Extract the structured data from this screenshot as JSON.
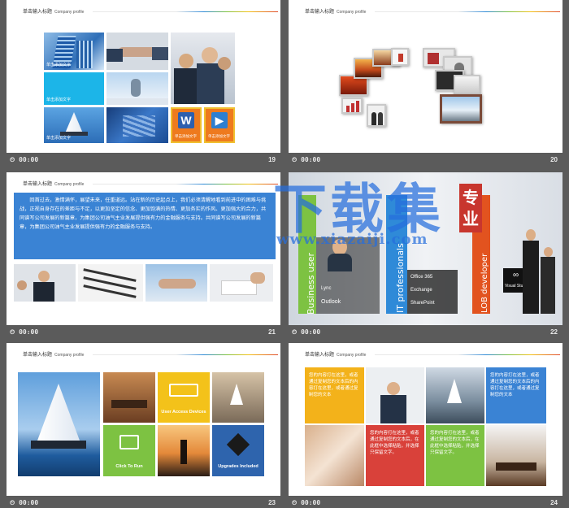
{
  "slides": [
    {
      "num": "19",
      "time": "00:00",
      "title": "单击输入标题",
      "subtitle": "Company profile",
      "captions": [
        "单击添加文字",
        "单击添加文字",
        "单击添加文字",
        "单击添加文字",
        "单击添加文字"
      ]
    },
    {
      "num": "20",
      "time": "00:00",
      "title": "单击输入标题",
      "subtitle": "Company profile"
    },
    {
      "num": "21",
      "time": "00:00",
      "title": "单击输入标题",
      "subtitle": "Company profile",
      "paragraph": "回首过去，激情满怀，展望未来，任重道远。站在新的历史起点上，我们必须清醒地看到前进中的困难与挑战，正视自身存在的差距与不足，以更加坚定的信念、更加饱满的热情、更加务实的作风、更加强大的合力，共同谱写公司发展的新篇章，为集团公司油气主业发展提供强有力的金融服务与支持。共同谱写公司发展的新篇章，为集团公司油气主业发展提供强有力的金融服务与支持。"
    },
    {
      "num": "22",
      "time": "00:00",
      "banners": [
        "Business  user",
        "IT professionals",
        "LOB developer"
      ],
      "products_left": [
        "Lync",
        "Outlook"
      ],
      "products_right": [
        "Office 365",
        "Exchange",
        "SharePoint"
      ],
      "vs_label": "Visual Studio",
      "tag": "专业"
    },
    {
      "num": "23",
      "time": "00:00",
      "title": "单击输入标题",
      "subtitle": "Company profile",
      "tiles": [
        "User Access Devices",
        "Click To Run",
        "Upgrades Included"
      ]
    },
    {
      "num": "24",
      "time": "00:00",
      "title": "单击输入标题",
      "subtitle": "Company profile",
      "blurb": "您的内容打在这里，或者通过复制您的文本后，在此框中选择粘贴，并选择只保留文字。",
      "blurb_short": "您的内容打在这里，或者通过复制您的文本后的内容打在这里，或者通过复制您的文本"
    }
  ],
  "watermark": {
    "cn": "下载集",
    "url": "www.xiazaiji.com"
  },
  "colors": {
    "blue": "#3a83d4",
    "green": "#7dc242",
    "orange": "#ee7a1e",
    "red": "#d9413a",
    "yellow": "#f3c21a",
    "cyan": "#1ab6e8",
    "navy": "#2e64ad"
  }
}
